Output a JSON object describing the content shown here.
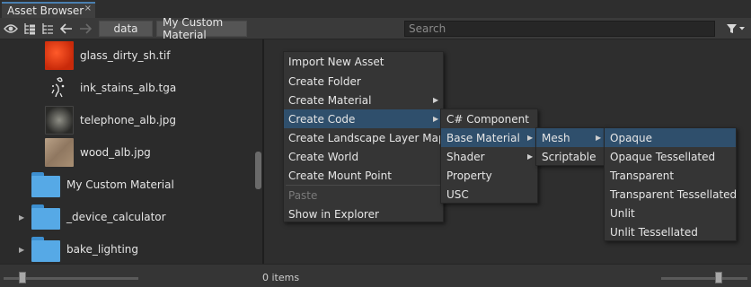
{
  "tab": {
    "title": "Asset Browser",
    "close": "×"
  },
  "toolbar": {
    "icons": {
      "visibility": "eye-icon",
      "tree": "tree-icon",
      "tree_alt": "hierarchy-icon",
      "back": "back-arrow-icon",
      "forward": "forward-arrow-icon",
      "filter": "filter-icon"
    },
    "breadcrumbs": [
      "data",
      "My Custom Material"
    ],
    "search_placeholder": "Search"
  },
  "file_list": [
    {
      "label": "glass_dirty_sh.tif",
      "kind": "texture"
    },
    {
      "label": "ink_stains_alb.tga",
      "kind": "texture"
    },
    {
      "label": "telephone_alb.jpg",
      "kind": "texture"
    },
    {
      "label": "wood_alb.jpg",
      "kind": "texture"
    },
    {
      "label": "My Custom Material",
      "kind": "folder"
    },
    {
      "label": "_device_calculator",
      "kind": "folder"
    },
    {
      "label": "bake_lighting",
      "kind": "folder"
    }
  ],
  "status": {
    "items": "0 items"
  },
  "context_menu": {
    "items": [
      "Import New Asset",
      "Create Folder",
      "Create Material",
      "Create Code",
      "Create Landscape Layer Map",
      "Create World",
      "Create Mount Point",
      "Paste",
      "Show in Explorer"
    ]
  },
  "code_menu": {
    "items": [
      "C# Component",
      "Base Material",
      "Shader",
      "Property",
      "USC"
    ]
  },
  "base_material_menu": {
    "items": [
      "Mesh",
      "Scriptable"
    ]
  },
  "mesh_menu": {
    "items": [
      "Opaque",
      "Opaque Tessellated",
      "Transparent",
      "Transparent Tessellated",
      "Unlit",
      "Unlit Tessellated"
    ]
  },
  "colors": {
    "highlight": "#2f4f6c",
    "accent": "#4a7fb0",
    "folder": "#56a9e6"
  }
}
